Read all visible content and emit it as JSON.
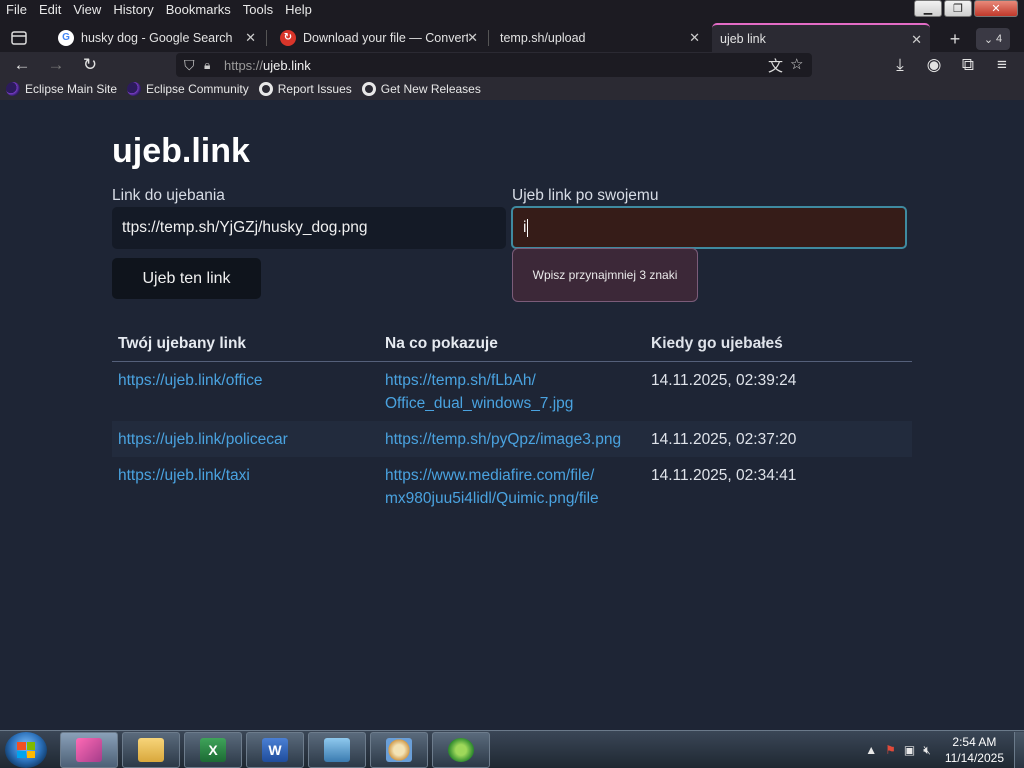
{
  "menu": [
    "File",
    "Edit",
    "View",
    "History",
    "Bookmarks",
    "Tools",
    "Help"
  ],
  "tabs": [
    {
      "title": "husky dog - Google Search",
      "icon": "google-icon",
      "active": false
    },
    {
      "title": "Download your file — Converti",
      "icon": "converter-icon",
      "active": false
    },
    {
      "title": "temp.sh/upload",
      "icon": "",
      "active": false
    },
    {
      "title": "ujeb link",
      "icon": "",
      "active": true
    }
  ],
  "tab_count": "4",
  "url": {
    "protocol": "https://",
    "host": "ujeb.link"
  },
  "bookmarks": [
    {
      "label": "Eclipse Main Site",
      "icon": "eclipse-icon"
    },
    {
      "label": "Eclipse Community",
      "icon": "eclipse-icon"
    },
    {
      "label": "Report Issues",
      "icon": "github-icon"
    },
    {
      "label": "Get New Releases",
      "icon": "github-icon"
    }
  ],
  "page": {
    "title": "ujeb.link",
    "link_label": "Link do ujebania",
    "link_value": "ttps://temp.sh/YjGZj/husky_dog.png",
    "custom_label": "Ujeb link po swojemu",
    "custom_value": "i",
    "tooltip": "Wpisz przynajmniej 3 znaki",
    "submit": "Ujeb ten link",
    "table": {
      "headers": [
        "Twój ujebany link",
        "Na co pokazuje",
        "Kiedy go ujebałeś"
      ],
      "rows": [
        {
          "short": "https://ujeb.link/office",
          "target_lines": [
            "https://temp.sh/fLbAh/",
            "Office_dual_windows_7.jpg"
          ],
          "date": "14.11.2025, 02:39:24"
        },
        {
          "short": "https://ujeb.link/policecar",
          "target_lines": [
            "https://temp.sh/pyQpz/image3.png"
          ],
          "date": "14.11.2025, 02:37:20"
        },
        {
          "short": "https://ujeb.link/taxi",
          "target_lines": [
            "https://www.mediafire.com/file/",
            "mx980juu5i4lidl/Quimic.png/file"
          ],
          "date": "14.11.2025, 02:34:41"
        }
      ]
    }
  },
  "taskbar": {
    "apps": [
      "firefox-icon",
      "explorer-icon",
      "excel-icon",
      "word-icon",
      "picture-viewer-icon",
      "paint-icon",
      "media-center-icon"
    ],
    "time": "2:54 AM",
    "date": "11/14/2025"
  },
  "colors": {
    "accent_tab": "#e36cc6",
    "link": "#4aa3e0",
    "page_bg": "#1e2535"
  }
}
